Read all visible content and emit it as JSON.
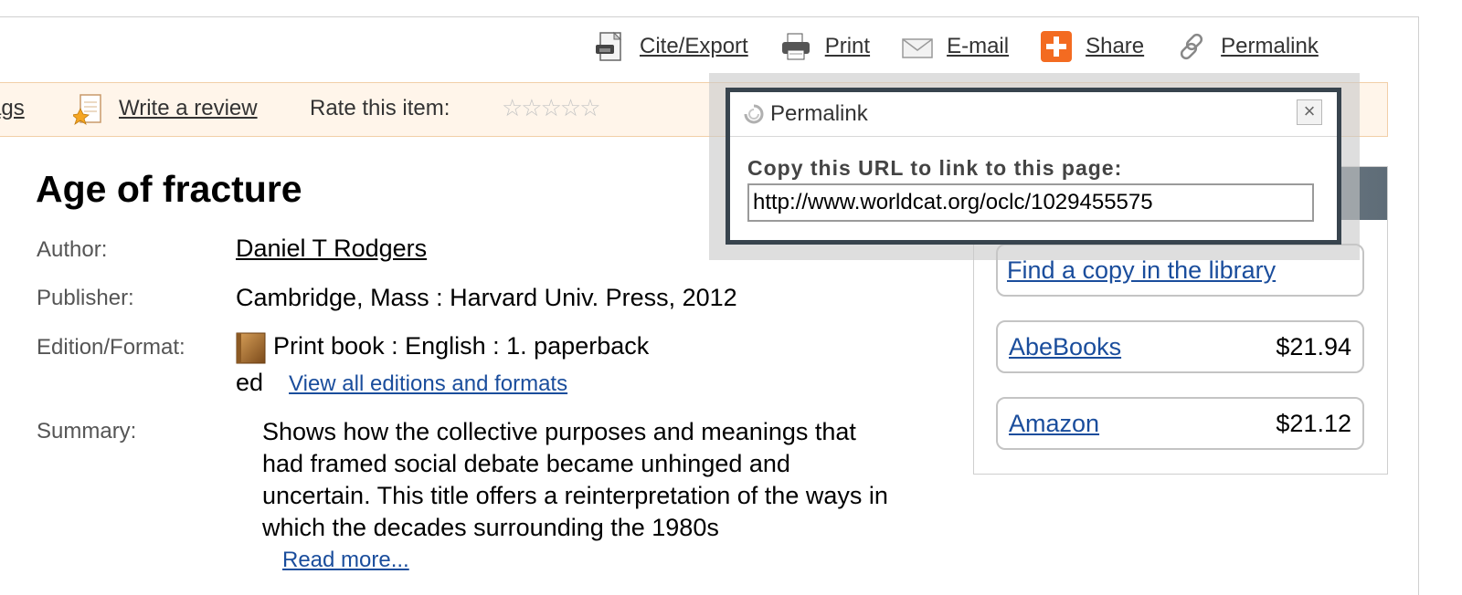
{
  "toolbar": {
    "cite_label": "Cite/Export",
    "print_label": "Print",
    "email_label": "E-mail",
    "share_label": "Share",
    "permalink_label": "Permalink"
  },
  "action_bar": {
    "tags_label": "ags",
    "review_label": "Write a review",
    "rate_label": "Rate this item:",
    "stars": "☆☆☆☆☆"
  },
  "record": {
    "title": "Age of fracture",
    "author_label": "Author:",
    "author": "Daniel T Rodgers",
    "publisher_label": "Publisher:",
    "publisher": "Cambridge, Mass : Harvard Univ. Press, 2012",
    "edition_label": "Edition/Format:",
    "edition_line1": "Print book : English : 1. paperback",
    "edition_line2": "ed",
    "editions_link": "View all editions and formats",
    "summary_label": "Summary:",
    "summary": "Shows how the collective purposes and meanings that had framed social debate became unhinged and uncertain. This title offers a reinterpretation of the ways in which the decades surrounding the 1980s",
    "read_more": "Read more..."
  },
  "purchase": {
    "library_link": "Find a copy in the library",
    "sellers": [
      {
        "name": "AbeBooks",
        "price": "$21.94"
      },
      {
        "name": "Amazon",
        "price": "$21.12"
      }
    ]
  },
  "permalink_popup": {
    "title": "Permalink",
    "close": "×",
    "copy_label": "Copy this URL to link to this page:",
    "url": "http://www.worldcat.org/oclc/1029455575"
  }
}
